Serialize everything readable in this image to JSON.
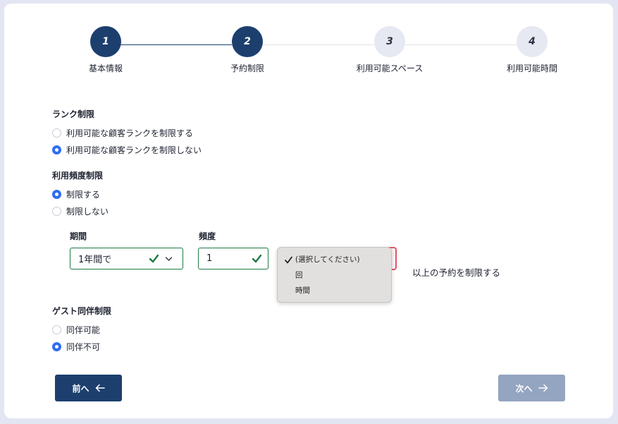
{
  "stepper": {
    "steps": [
      {
        "number": "1",
        "label": "基本情報"
      },
      {
        "number": "2",
        "label": "予約制限"
      },
      {
        "number": "3",
        "label": "利用可能スペース"
      },
      {
        "number": "4",
        "label": "利用可能時間"
      }
    ]
  },
  "rank_limit": {
    "title": "ランク制限",
    "options": [
      {
        "label": "利用可能な顧客ランクを制限する",
        "checked": false
      },
      {
        "label": "利用可能な顧客ランクを制限しない",
        "checked": true
      }
    ]
  },
  "frequency_limit": {
    "title": "利用頻度制限",
    "options": [
      {
        "label": "制限する",
        "checked": true
      },
      {
        "label": "制限しない",
        "checked": false
      }
    ],
    "period_label": "期間",
    "period_value": "1年間で",
    "frequency_label": "頻度",
    "frequency_value": "1",
    "unit_dropdown": {
      "options": [
        {
          "label": "(選択してください)",
          "selected": true
        },
        {
          "label": "回",
          "selected": false
        },
        {
          "label": "時間",
          "selected": false
        }
      ]
    },
    "suffix": "以上の予約を制限する"
  },
  "guest_limit": {
    "title": "ゲスト同伴制限",
    "options": [
      {
        "label": "同伴可能",
        "checked": false
      },
      {
        "label": "同伴不可",
        "checked": true
      }
    ]
  },
  "buttons": {
    "prev_label": "前へ",
    "next_label": "次へ"
  },
  "colors": {
    "primary": "#1c3f6e",
    "radio_accent": "#2f6df0",
    "valid_green": "#1e7a43",
    "error_red": "#e25563",
    "disabled_button": "#94a5c1"
  }
}
